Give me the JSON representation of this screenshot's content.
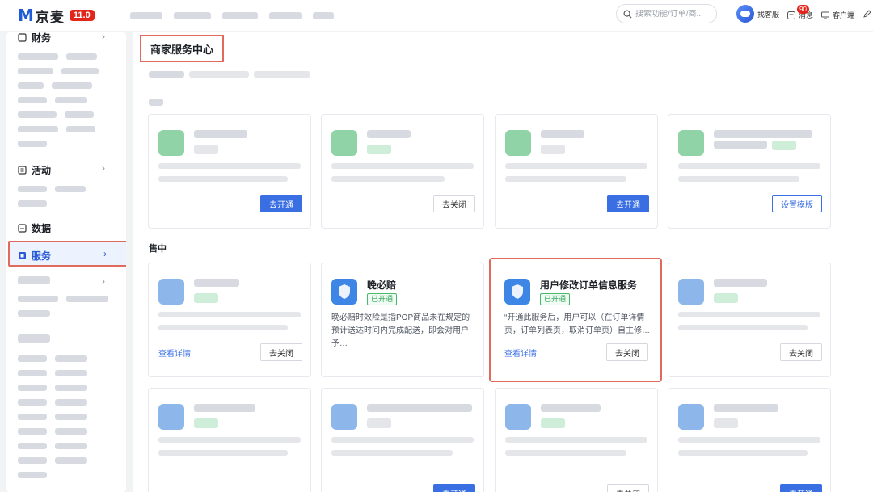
{
  "app": {
    "logo_text": "京麦",
    "version": "11.0"
  },
  "search": {
    "placeholder": "搜索功能/订单/商..."
  },
  "topbar": {
    "customer_service": "找客服",
    "messages": "消息",
    "message_count": "90",
    "client": "客户端"
  },
  "sidebar": {
    "items": [
      {
        "label": "财务"
      },
      {
        "label": "活动"
      },
      {
        "label": "数据"
      },
      {
        "label": "服务"
      }
    ]
  },
  "page": {
    "title": "商家服务中心"
  },
  "sections": {
    "in_sale": "售中"
  },
  "cards": {
    "wanbipei": {
      "title": "晚必赔",
      "tag": "已开通",
      "desc": "晚必赔时效险是指POP商品未在规定的预计送达时间内完成配送，即会对用户予…"
    },
    "modify_order": {
      "title": "用户修改订单信息服务",
      "tag": "已开通",
      "desc": "“开通此服务后，用户可以（在订单详情页，订单列表页，取消订单页）自主修…",
      "detail": "查看详情",
      "action": "去关闭"
    }
  },
  "buttons": {
    "open": "去开通",
    "close": "去关闭",
    "template": "设置模版",
    "detail": "查看详情"
  },
  "colors": {
    "brand_blue": "#3a6fe3",
    "logo_red": "#e1251b",
    "highlight": "#e06a5c",
    "tag_green": "#2aa355"
  }
}
